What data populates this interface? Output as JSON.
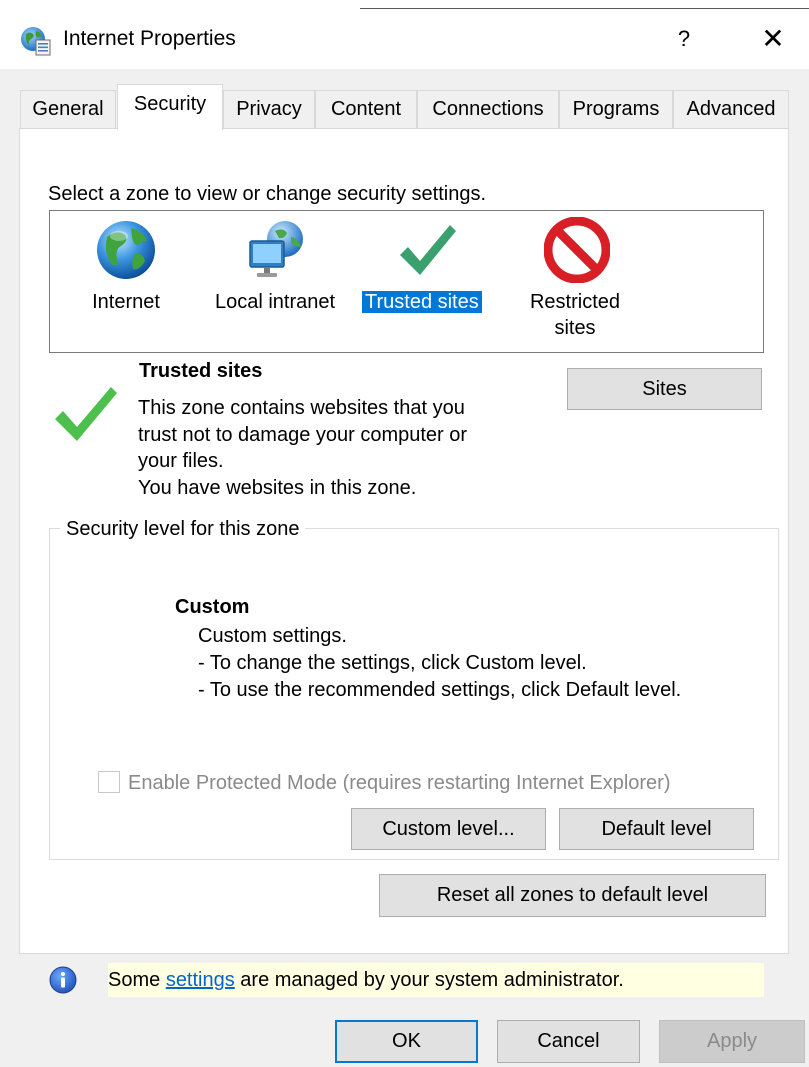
{
  "window": {
    "title": "Internet Properties",
    "help_label": "?",
    "close_label": "✕"
  },
  "tabs": [
    {
      "label": "General",
      "active": false
    },
    {
      "label": "Security",
      "active": true
    },
    {
      "label": "Privacy",
      "active": false
    },
    {
      "label": "Content",
      "active": false
    },
    {
      "label": "Connections",
      "active": false
    },
    {
      "label": "Programs",
      "active": false
    },
    {
      "label": "Advanced",
      "active": false
    }
  ],
  "security": {
    "zone_prompt": "Select a zone to view or change security settings.",
    "zones": [
      {
        "label": "Internet",
        "icon": "globe-icon"
      },
      {
        "label": "Local intranet",
        "icon": "local-intranet-icon"
      },
      {
        "label": "Trusted sites",
        "icon": "checkmark-icon",
        "selected": true
      },
      {
        "label_line1": "Restricted",
        "label_line2": "sites",
        "icon": "restricted-icon"
      }
    ],
    "selected_zone": {
      "heading": "Trusted sites",
      "description_lines": [
        "This zone contains websites that you",
        "trust not to damage your computer or",
        "your files.",
        "You have websites in this zone."
      ],
      "sites_button": "Sites"
    },
    "level_group": {
      "title": "Security level for this zone",
      "level_name": "Custom",
      "level_lines": [
        "Custom settings.",
        "- To change the settings, click Custom level.",
        "- To use the recommended settings, click Default level."
      ],
      "protected_mode_label": "Enable Protected Mode (requires restarting Internet Explorer)",
      "protected_mode_checked": false,
      "custom_level_button": "Custom level...",
      "default_level_button": "Default level"
    },
    "reset_all_button": "Reset all zones to default level",
    "info": {
      "prefix": "Some ",
      "link": "settings",
      "suffix": " are managed by your system administrator."
    }
  },
  "footer": {
    "ok": "OK",
    "cancel": "Cancel",
    "apply": "Apply"
  },
  "colors": {
    "selection": "#0078d7",
    "check_green": "#4caf50",
    "restricted_red": "#d81f26",
    "info_bar": "#ffffe1",
    "link": "#0066cc"
  }
}
